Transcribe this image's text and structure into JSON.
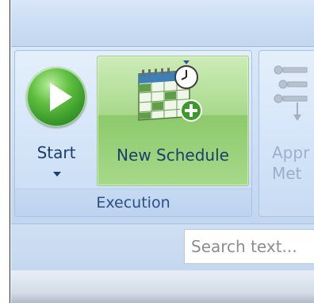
{
  "ribbon": {
    "groups": [
      {
        "label": "Execution",
        "buttons": [
          {
            "label": "Start",
            "icon": "play-icon"
          },
          {
            "label": "New Schedule",
            "icon": "calendar-clock-add-icon"
          }
        ]
      },
      {
        "buttons": [
          {
            "label_line1": "Appr",
            "label_line2": "Met",
            "icon": "approval-method-icon"
          }
        ]
      }
    ]
  },
  "search": {
    "placeholder": "Search text..."
  },
  "colors": {
    "accent_green": "#8dca6c",
    "ribbon_blue": "#cfe0f6",
    "label_text": "#1d3d6b"
  }
}
